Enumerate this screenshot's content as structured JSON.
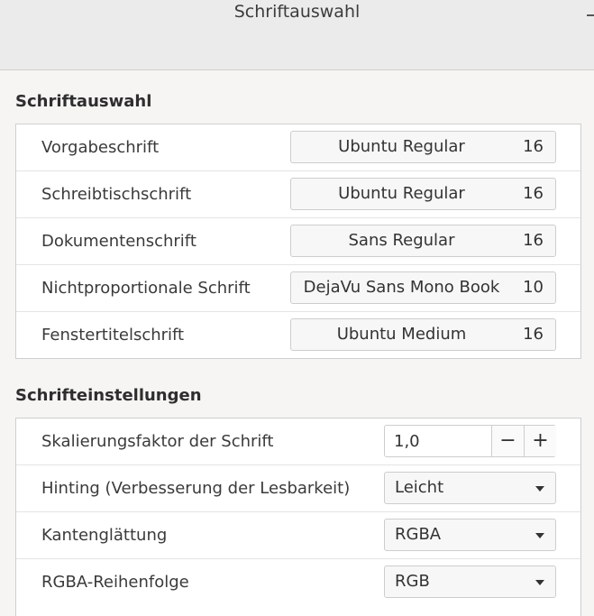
{
  "window": {
    "title": "Schriftauswahl"
  },
  "font_selection": {
    "title": "Schriftauswahl",
    "rows": [
      {
        "label": "Vorgabeschrift",
        "font": "Ubuntu Regular",
        "size": "16"
      },
      {
        "label": "Schreibtischschrift",
        "font": "Ubuntu Regular",
        "size": "16"
      },
      {
        "label": "Dokumentenschrift",
        "font": "Sans Regular",
        "size": "16"
      },
      {
        "label": "Nichtproportionale Schrift",
        "font": "DejaVu Sans Mono Book",
        "size": "10"
      },
      {
        "label": "Fenstertitelschrift",
        "font": "Ubuntu Medium",
        "size": "16"
      }
    ]
  },
  "font_settings": {
    "title": "Schrifteinstellungen",
    "scaling": {
      "label": "Skalierungsfaktor der Schrift",
      "value": "1,0",
      "minus": "−",
      "plus": "+"
    },
    "hinting": {
      "label": "Hinting (Verbesserung der Lesbarkeit)",
      "value": "Leicht"
    },
    "antialiasing": {
      "label": "Kantenglättung",
      "value": "RGBA"
    },
    "rgba_order": {
      "label": "RGBA-Reihenfolge",
      "value": "RGB"
    }
  }
}
